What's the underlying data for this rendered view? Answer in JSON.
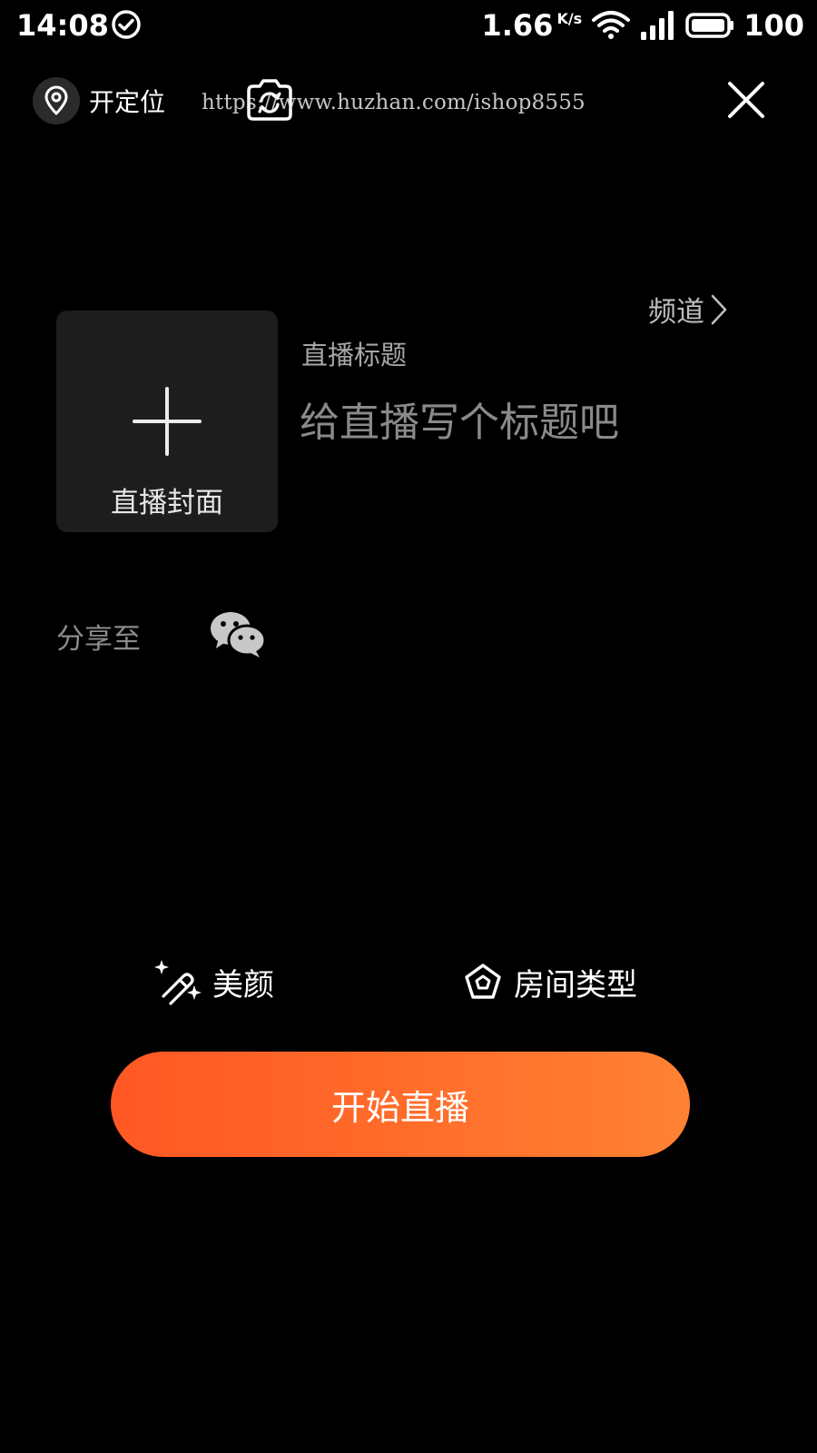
{
  "status_bar": {
    "time": "14:08",
    "net_speed": "1.66",
    "net_speed_unit": "K/s",
    "battery": "100",
    "icons": [
      "check-circle-icon",
      "wifi-icon",
      "signal-icon",
      "battery-icon"
    ]
  },
  "top_bar": {
    "location_label": "开定位",
    "watermark": "https://www.huzhan.com/ishop8555",
    "icons": [
      "location-pin-icon",
      "flip-camera-icon",
      "close-icon"
    ]
  },
  "cover": {
    "label": "直播封面",
    "icon": "plus-icon"
  },
  "channel": {
    "label": "频道"
  },
  "title": {
    "caption": "直播标题",
    "placeholder": "给直播写个标题吧",
    "value": ""
  },
  "share": {
    "label": "分享至",
    "icon": "wechat-icon"
  },
  "options": {
    "beauty_label": "美颜",
    "room_type_label": "房间类型"
  },
  "start_button": {
    "label": "开始直播"
  },
  "colors": {
    "background": "#000000",
    "accent_start": "#ff5724",
    "accent_end": "#ff8233",
    "cover_bg": "#1d1d1d"
  }
}
